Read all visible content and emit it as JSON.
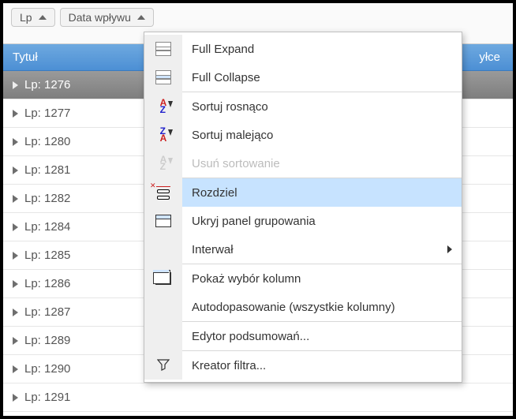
{
  "group_area": {
    "chips": [
      {
        "label": "Lp"
      },
      {
        "label": "Data wpływu"
      }
    ]
  },
  "columns": {
    "title": "Tytuł",
    "right": "yłce"
  },
  "rows": [
    {
      "label": "Lp: 1276",
      "selected": true
    },
    {
      "label": "Lp: 1277"
    },
    {
      "label": "Lp: 1280"
    },
    {
      "label": "Lp: 1281"
    },
    {
      "label": "Lp: 1282"
    },
    {
      "label": "Lp: 1284"
    },
    {
      "label": "Lp: 1285"
    },
    {
      "label": "Lp: 1286"
    },
    {
      "label": "Lp: 1287"
    },
    {
      "label": "Lp: 1289"
    },
    {
      "label": "Lp: 1290"
    },
    {
      "label": "Lp: 1291"
    }
  ],
  "menu": {
    "full_expand": "Full Expand",
    "full_collapse": "Full Collapse",
    "sort_asc": "Sortuj rosnąco",
    "sort_desc": "Sortuj malejąco",
    "clear_sort": "Usuń sortowanie",
    "ungroup": "Rozdziel",
    "hide_group_panel": "Ukryj panel grupowania",
    "interval": "Interwał",
    "column_chooser": "Pokaż wybór kolumn",
    "autofit": "Autodopasowanie (wszystkie kolumny)",
    "summary_editor": "Edytor podsumowań...",
    "filter_wizard": "Kreator filtra..."
  }
}
